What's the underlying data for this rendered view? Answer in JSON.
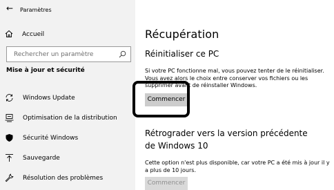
{
  "window": {
    "title": "Paramètres"
  },
  "sidebar": {
    "home_label": "Accueil",
    "search_placeholder": "Rechercher un paramètre",
    "section_title": "Mise à jour et sécurité",
    "items": [
      {
        "label": "Windows Update",
        "icon": "sync-icon"
      },
      {
        "label": "Optimisation de la distribution",
        "icon": "delivery-optimization-icon"
      },
      {
        "label": "Sécurité Windows",
        "icon": "shield-icon"
      },
      {
        "label": "Sauvegarde",
        "icon": "backup-icon"
      },
      {
        "label": "Résolution des problèmes",
        "icon": "wrench-icon"
      }
    ]
  },
  "main": {
    "title": "Récupération",
    "reset": {
      "heading": "Réinitialiser ce PC",
      "description": "Si votre PC fonctionne mal, vous pouvez tenter de le réinitialiser. Vous avez alors le choix entre conserver vos fichiers ou les supprimer avant de réinstaller Windows.",
      "button": "Commencer"
    },
    "rollback": {
      "heading": "Rétrograder vers la version précédente de Windows 10",
      "description": "Cette option n'est plus disponible, car votre PC a été mis à jour il y a plus de 10 jours.",
      "button": "Commencer"
    }
  }
}
